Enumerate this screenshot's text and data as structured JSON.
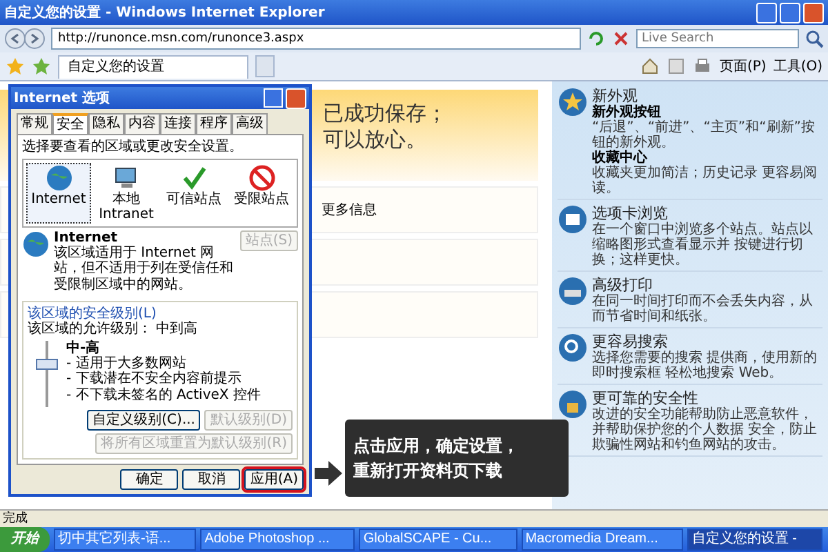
{
  "window": {
    "title": "自定义您的设置 - Windows Internet Explorer"
  },
  "address_bar": {
    "url": "http://runonce.msn.com/runonce3.aspx"
  },
  "search": {
    "placeholder": "Live Search"
  },
  "tab": {
    "label": "自定义您的设置"
  },
  "toolbar": {
    "page_menu": "页面(P)",
    "tools_menu": "工具(O)"
  },
  "page": {
    "heading_lines": [
      "已成功保存；",
      "可以放心。"
    ],
    "cards": [
      {
        "text": "更多信息"
      }
    ]
  },
  "features": [
    {
      "title": "新外观",
      "entries": [
        {
          "heading": "新外观按钮",
          "text": "“后退”、“前进”、“主页”和“刷新”按钮的新外观。"
        },
        {
          "heading": "收藏中心",
          "text": "收藏夹更加简洁；历史记录 更容易阅读。"
        }
      ]
    },
    {
      "title": "选项卡浏览",
      "entries": [
        {
          "text": "在一个窗口中浏览多个站点。站点以缩略图形式查看显示并 按键进行切换；这样更快。"
        }
      ]
    },
    {
      "title": "高级打印",
      "entries": [
        {
          "text": "在同一时间打印而不会丢失内容，从而节省时间和纸张。"
        }
      ]
    },
    {
      "title": "更容易搜索",
      "entries": [
        {
          "text": "选择您需要的搜索 提供商，使用新的即时搜索框 轻松地搜索 Web。"
        }
      ]
    },
    {
      "title": "更可靠的安全性",
      "entries": [
        {
          "text": "改进的安全功能帮助防止恶意软件，并帮助保护您的个人数据 安全，防止欺骗性网站和钓鱼网站的攻击。"
        }
      ]
    }
  ],
  "dialog": {
    "title": "Internet 选项",
    "tabs": [
      {
        "label": "常规",
        "selected": false
      },
      {
        "label": "安全",
        "selected": true
      },
      {
        "label": "隐私",
        "selected": false
      },
      {
        "label": "内容",
        "selected": false
      },
      {
        "label": "连接",
        "selected": false
      },
      {
        "label": "程序",
        "selected": false
      },
      {
        "label": "高级",
        "selected": false
      }
    ],
    "instruction": "选择要查看的区域或更改安全设置。",
    "zones": [
      {
        "label": "Internet",
        "selected": true
      },
      {
        "label": "本地 Intranet",
        "selected": false
      },
      {
        "label": "可信站点",
        "selected": false
      },
      {
        "label": "受限站点",
        "selected": false
      }
    ],
    "zone_heading": "Internet",
    "zone_description": "该区域适用于 Internet 网站，但不适用于列在受信任和受限制区域中的网站。",
    "sites_button": {
      "label": "站点(S)",
      "disabled": true
    },
    "security_group": "该区域的安全级别(L)",
    "allowed_levels": "该区域的允许级别： 中到高",
    "slider": {
      "level": 0.67
    },
    "level_name": "中-高",
    "level_points": [
      "- 适用于大多数网站",
      "- 下载潜在不安全内容前提示",
      "- 不下载未签名的 ActiveX 控件"
    ],
    "custom_button": {
      "label": "自定义级别(C)...",
      "disabled": false
    },
    "default_button": {
      "label": "默认级别(D)",
      "disabled": true
    },
    "reset_button": {
      "label": "将所有区域重置为默认级别(R)",
      "disabled": true
    },
    "buttons": [
      {
        "label": "确定",
        "highlighted": false
      },
      {
        "label": "取消",
        "highlighted": false
      },
      {
        "label": "应用(A)",
        "highlighted": true
      }
    ]
  },
  "callout": {
    "lines": [
      "点击应用，确定设置，",
      "重新打开资料页下载"
    ]
  },
  "status_bar": {
    "text": "完成"
  },
  "taskbar": {
    "start": "开始",
    "items": [
      {
        "label": "切中其它列表-语...",
        "selected": false
      },
      {
        "label": "Adobe Photoshop ...",
        "selected": false
      },
      {
        "label": "GlobalSCAPE - Cu...",
        "selected": false
      },
      {
        "label": "Macromedia Dream...",
        "selected": false
      },
      {
        "label": "自定义您的设置 -",
        "selected": true
      }
    ]
  }
}
